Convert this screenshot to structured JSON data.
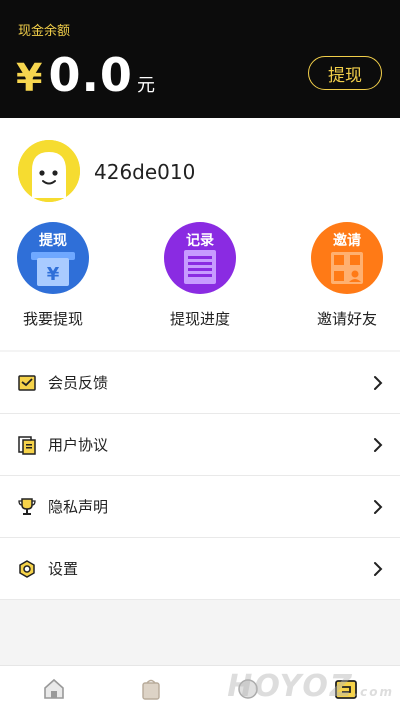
{
  "header": {
    "balance_label": "现金余额",
    "currency_symbol": "¥",
    "amount": "0.0",
    "unit": "元",
    "withdraw_button": "提现"
  },
  "profile": {
    "username": "426de010"
  },
  "actions": [
    {
      "badge": "提现",
      "label": "我要提现",
      "icon": "withdraw-icon"
    },
    {
      "badge": "记录",
      "label": "提现进度",
      "icon": "records-icon"
    },
    {
      "badge": "邀请",
      "label": "邀请好友",
      "icon": "invite-qr-icon"
    }
  ],
  "menu": [
    {
      "label": "会员反馈",
      "icon": "feedback-icon"
    },
    {
      "label": "用户协议",
      "icon": "agreement-icon"
    },
    {
      "label": "隐私声明",
      "icon": "trophy-icon"
    },
    {
      "label": "设置",
      "icon": "settings-icon"
    }
  ],
  "tabbar": [
    {
      "icon": "home-icon"
    },
    {
      "icon": "bag-icon"
    },
    {
      "icon": "circle-icon"
    },
    {
      "icon": "profile-tab-icon"
    }
  ],
  "watermark": {
    "text": "HOYOZ",
    "suffix": ".com"
  },
  "colors": {
    "accent_gold": "#f7d64f",
    "header_bg": "#0c0c0c",
    "withdraw_blue": "#2f6fd8",
    "records_purple": "#8a2be2",
    "invite_orange": "#ff7a16"
  }
}
